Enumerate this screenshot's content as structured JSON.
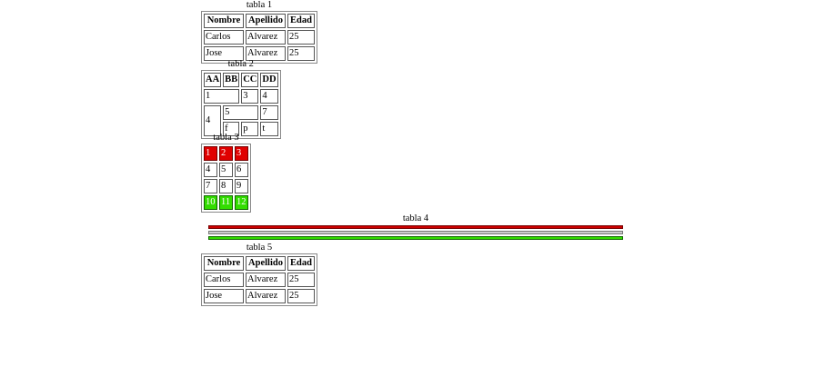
{
  "tabla1": {
    "caption": "tabla 1",
    "headers": [
      "Nombre",
      "Apellido",
      "Edad"
    ],
    "rows": [
      [
        "Carlos",
        "Alvarez",
        "25"
      ],
      [
        "Jose",
        "Alvarez",
        "25"
      ]
    ]
  },
  "tabla2": {
    "caption": "tabla 2",
    "headers": [
      "AA",
      "BB",
      "CC",
      "DD"
    ],
    "row1": [
      "1",
      "3",
      "4"
    ],
    "row2": [
      "4",
      "5",
      "7"
    ],
    "row3": [
      "f",
      "p",
      "t"
    ]
  },
  "tabla3": {
    "caption": "tabla 3",
    "rows": [
      [
        "1",
        "2",
        "3"
      ],
      [
        "4",
        "5",
        "6"
      ],
      [
        "7",
        "8",
        "9"
      ],
      [
        "10",
        "11",
        "12"
      ]
    ],
    "colors": {
      "red_row": "#e00000",
      "green_row": "#33dd00"
    }
  },
  "tabla4": {
    "caption": "tabla 4",
    "colors": [
      "#cc0000",
      "#cccccc",
      "#33dd00"
    ]
  },
  "tabla5": {
    "caption": "tabla 5",
    "headers": [
      "Nombre",
      "Apellido",
      "Edad"
    ],
    "rows": [
      [
        "Carlos",
        "Alvarez",
        "25"
      ],
      [
        "Jose",
        "Alvarez",
        "25"
      ]
    ]
  }
}
